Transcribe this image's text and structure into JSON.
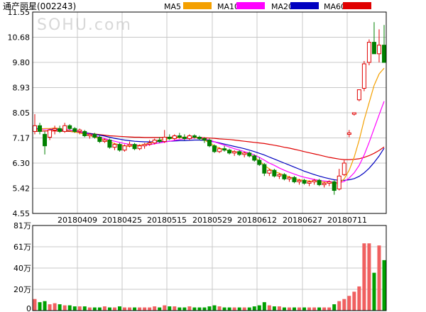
{
  "chart_data": {
    "type": "candlestick",
    "title": "通产丽星(002243)",
    "watermark": "SOHU.com",
    "price_axis": {
      "ticks": [
        "11.55",
        "10.68",
        "9.80",
        "8.93",
        "8.05",
        "7.17",
        "6.30",
        "5.42",
        "4.55"
      ],
      "min": 4.55,
      "max": 11.55
    },
    "volume_axis": {
      "ticks": [
        "81万",
        "61万",
        "40万",
        "20万",
        "0"
      ],
      "max_wan": 81
    },
    "x_tick_labels": [
      "20180409",
      "20180425",
      "20180515",
      "20180529",
      "20180612",
      "20180627",
      "20180711"
    ],
    "legend": [
      {
        "name": "MA5",
        "color": "#f4a000"
      },
      {
        "name": "MA10",
        "color": "#ff00ff"
      },
      {
        "name": "MA20",
        "color": "#0000c0"
      },
      {
        "name": "MA60",
        "color": "#e00000"
      }
    ],
    "colors": {
      "up": "#e00000",
      "down": "#008000",
      "grid": "#c8c8c8",
      "axis": "#000000"
    },
    "candles": [
      {
        "o": 7.4,
        "h": 8.0,
        "l": 7.3,
        "c": 7.6
      },
      {
        "o": 7.6,
        "h": 7.7,
        "l": 7.3,
        "c": 7.4
      },
      {
        "o": 7.3,
        "h": 7.4,
        "l": 6.6,
        "c": 6.9
      },
      {
        "o": 7.2,
        "h": 7.5,
        "l": 7.1,
        "c": 7.45
      },
      {
        "o": 7.45,
        "h": 7.6,
        "l": 7.3,
        "c": 7.5
      },
      {
        "o": 7.5,
        "h": 7.6,
        "l": 7.35,
        "c": 7.4
      },
      {
        "o": 7.4,
        "h": 7.7,
        "l": 7.35,
        "c": 7.6
      },
      {
        "o": 7.6,
        "h": 7.65,
        "l": 7.45,
        "c": 7.5
      },
      {
        "o": 7.5,
        "h": 7.55,
        "l": 7.35,
        "c": 7.4
      },
      {
        "o": 7.4,
        "h": 7.5,
        "l": 7.3,
        "c": 7.45
      },
      {
        "o": 7.4,
        "h": 7.45,
        "l": 7.2,
        "c": 7.25
      },
      {
        "o": 7.25,
        "h": 7.35,
        "l": 7.15,
        "c": 7.3
      },
      {
        "o": 7.3,
        "h": 7.35,
        "l": 7.15,
        "c": 7.2
      },
      {
        "o": 7.2,
        "h": 7.25,
        "l": 7.0,
        "c": 7.05
      },
      {
        "o": 7.05,
        "h": 7.15,
        "l": 7.0,
        "c": 7.1
      },
      {
        "o": 7.1,
        "h": 7.15,
        "l": 6.8,
        "c": 6.85
      },
      {
        "o": 6.85,
        "h": 7.0,
        "l": 6.75,
        "c": 6.95
      },
      {
        "o": 6.95,
        "h": 7.0,
        "l": 6.7,
        "c": 6.75
      },
      {
        "o": 6.75,
        "h": 6.95,
        "l": 6.7,
        "c": 6.9
      },
      {
        "o": 6.9,
        "h": 7.05,
        "l": 6.85,
        "c": 6.95
      },
      {
        "o": 6.95,
        "h": 7.0,
        "l": 6.75,
        "c": 6.8
      },
      {
        "o": 6.8,
        "h": 6.95,
        "l": 6.75,
        "c": 6.9
      },
      {
        "o": 6.9,
        "h": 7.0,
        "l": 6.8,
        "c": 6.95
      },
      {
        "o": 6.95,
        "h": 7.1,
        "l": 6.9,
        "c": 7.0
      },
      {
        "o": 7.0,
        "h": 7.15,
        "l": 6.95,
        "c": 7.1
      },
      {
        "o": 7.1,
        "h": 7.2,
        "l": 7.0,
        "c": 7.05
      },
      {
        "o": 7.05,
        "h": 7.45,
        "l": 7.0,
        "c": 7.2
      },
      {
        "o": 7.2,
        "h": 7.3,
        "l": 7.1,
        "c": 7.15
      },
      {
        "o": 7.15,
        "h": 7.3,
        "l": 7.1,
        "c": 7.25
      },
      {
        "o": 7.25,
        "h": 7.35,
        "l": 7.15,
        "c": 7.2
      },
      {
        "o": 7.2,
        "h": 7.3,
        "l": 7.1,
        "c": 7.15
      },
      {
        "o": 7.15,
        "h": 7.3,
        "l": 7.1,
        "c": 7.25
      },
      {
        "o": 7.25,
        "h": 7.3,
        "l": 7.15,
        "c": 7.2
      },
      {
        "o": 7.2,
        "h": 7.25,
        "l": 7.1,
        "c": 7.15
      },
      {
        "o": 7.15,
        "h": 7.2,
        "l": 7.0,
        "c": 7.1
      },
      {
        "o": 7.1,
        "h": 7.15,
        "l": 6.85,
        "c": 6.9
      },
      {
        "o": 6.9,
        "h": 6.95,
        "l": 6.65,
        "c": 6.7
      },
      {
        "o": 6.7,
        "h": 6.85,
        "l": 6.65,
        "c": 6.8
      },
      {
        "o": 6.8,
        "h": 6.9,
        "l": 6.7,
        "c": 6.75
      },
      {
        "o": 6.75,
        "h": 6.8,
        "l": 6.6,
        "c": 6.65
      },
      {
        "o": 6.65,
        "h": 6.75,
        "l": 6.55,
        "c": 6.7
      },
      {
        "o": 6.7,
        "h": 6.75,
        "l": 6.55,
        "c": 6.6
      },
      {
        "o": 6.6,
        "h": 6.7,
        "l": 6.5,
        "c": 6.65
      },
      {
        "o": 6.65,
        "h": 6.7,
        "l": 6.5,
        "c": 6.55
      },
      {
        "o": 6.55,
        "h": 6.6,
        "l": 6.35,
        "c": 6.4
      },
      {
        "o": 6.4,
        "h": 6.5,
        "l": 6.2,
        "c": 6.25
      },
      {
        "o": 6.25,
        "h": 6.3,
        "l": 5.85,
        "c": 5.95
      },
      {
        "o": 5.95,
        "h": 6.1,
        "l": 5.85,
        "c": 6.05
      },
      {
        "o": 6.05,
        "h": 6.1,
        "l": 5.8,
        "c": 5.85
      },
      {
        "o": 5.85,
        "h": 5.95,
        "l": 5.75,
        "c": 5.9
      },
      {
        "o": 5.9,
        "h": 5.95,
        "l": 5.7,
        "c": 5.75
      },
      {
        "o": 5.75,
        "h": 5.85,
        "l": 5.65,
        "c": 5.8
      },
      {
        "o": 5.8,
        "h": 5.85,
        "l": 5.6,
        "c": 5.65
      },
      {
        "o": 5.65,
        "h": 5.75,
        "l": 5.55,
        "c": 5.7
      },
      {
        "o": 5.7,
        "h": 5.75,
        "l": 5.55,
        "c": 5.6
      },
      {
        "o": 5.6,
        "h": 5.7,
        "l": 5.5,
        "c": 5.65
      },
      {
        "o": 5.65,
        "h": 5.75,
        "l": 5.55,
        "c": 5.7
      },
      {
        "o": 5.7,
        "h": 5.75,
        "l": 5.5,
        "c": 5.55
      },
      {
        "o": 5.55,
        "h": 5.65,
        "l": 5.45,
        "c": 5.6
      },
      {
        "o": 5.6,
        "h": 5.7,
        "l": 5.5,
        "c": 5.65
      },
      {
        "o": 5.65,
        "h": 5.7,
        "l": 5.2,
        "c": 5.35
      },
      {
        "o": 5.4,
        "h": 6.1,
        "l": 5.35,
        "c": 5.85
      },
      {
        "o": 5.9,
        "h": 6.4,
        "l": 5.85,
        "c": 6.3
      },
      {
        "o": 7.3,
        "h": 7.45,
        "l": 7.2,
        "c": 7.35
      },
      {
        "o": 8.0,
        "h": 8.05,
        "l": 7.95,
        "c": 8.05
      },
      {
        "o": 8.5,
        "h": 8.85,
        "l": 8.45,
        "c": 8.85
      },
      {
        "o": 8.9,
        "h": 9.85,
        "l": 8.8,
        "c": 9.75
      },
      {
        "o": 9.8,
        "h": 10.6,
        "l": 9.7,
        "c": 10.5
      },
      {
        "o": 10.5,
        "h": 11.2,
        "l": 10.2,
        "c": 10.1
      },
      {
        "o": 10.1,
        "h": 10.95,
        "l": 9.8,
        "c": 10.4
      },
      {
        "o": 10.4,
        "h": 11.1,
        "l": 9.9,
        "c": 9.8
      }
    ],
    "ma5": [
      7.45,
      7.48,
      7.5,
      7.5,
      7.52,
      7.5,
      7.46,
      7.42,
      7.38,
      7.35,
      7.3,
      7.26,
      7.2,
      7.15,
      7.1,
      7.03,
      6.98,
      6.93,
      6.9,
      6.88,
      6.9,
      6.92,
      6.95,
      7.0,
      7.05,
      7.1,
      7.13,
      7.15,
      7.17,
      7.18,
      7.2,
      7.2,
      7.19,
      7.17,
      7.1,
      7.0,
      6.9,
      6.82,
      6.77,
      6.73,
      6.7,
      6.67,
      6.64,
      6.6,
      6.5,
      6.38,
      6.22,
      6.1,
      6.0,
      5.95,
      5.88,
      5.82,
      5.76,
      5.72,
      5.7,
      5.68,
      5.66,
      5.65,
      5.64,
      5.63,
      5.58,
      5.6,
      5.75,
      6.05,
      6.5,
      7.1,
      7.8,
      8.4,
      9.0,
      9.4,
      9.6
    ],
    "ma10": [
      7.45,
      7.47,
      7.48,
      7.49,
      7.5,
      7.49,
      7.47,
      7.45,
      7.42,
      7.39,
      7.35,
      7.3,
      7.25,
      7.2,
      7.15,
      7.1,
      7.06,
      7.02,
      6.98,
      6.95,
      6.93,
      6.92,
      6.92,
      6.94,
      6.97,
      7.0,
      7.03,
      7.06,
      7.09,
      7.12,
      7.14,
      7.16,
      7.17,
      7.17,
      7.15,
      7.1,
      7.04,
      6.98,
      6.92,
      6.86,
      6.8,
      6.75,
      6.7,
      6.65,
      6.58,
      6.5,
      6.4,
      6.3,
      6.22,
      6.13,
      6.05,
      5.98,
      5.92,
      5.86,
      5.81,
      5.77,
      5.73,
      5.7,
      5.68,
      5.66,
      5.63,
      5.62,
      5.66,
      5.78,
      5.96,
      6.22,
      6.58,
      7.02,
      7.5,
      7.98,
      8.45
    ],
    "ma20": [
      7.5,
      7.5,
      7.49,
      7.48,
      7.47,
      7.46,
      7.44,
      7.42,
      7.4,
      7.38,
      7.36,
      7.33,
      7.3,
      7.27,
      7.24,
      7.2,
      7.16,
      7.13,
      7.1,
      7.08,
      7.06,
      7.05,
      7.04,
      7.04,
      7.04,
      7.05,
      7.05,
      7.06,
      7.07,
      7.08,
      7.08,
      7.09,
      7.1,
      7.1,
      7.09,
      7.07,
      7.04,
      7.0,
      6.96,
      6.92,
      6.88,
      6.84,
      6.8,
      6.75,
      6.7,
      6.64,
      6.58,
      6.51,
      6.44,
      6.37,
      6.3,
      6.23,
      6.16,
      6.09,
      6.02,
      5.96,
      5.9,
      5.85,
      5.8,
      5.76,
      5.72,
      5.7,
      5.7,
      5.72,
      5.76,
      5.84,
      5.96,
      6.12,
      6.32,
      6.55,
      6.82
    ],
    "ma60": [
      7.4,
      7.41,
      7.42,
      7.42,
      7.42,
      7.41,
      7.41,
      7.4,
      7.38,
      7.36,
      7.35,
      7.33,
      7.31,
      7.29,
      7.27,
      7.25,
      7.24,
      7.23,
      7.22,
      7.21,
      7.2,
      7.2,
      7.19,
      7.19,
      7.19,
      7.19,
      7.19,
      7.2,
      7.2,
      7.2,
      7.2,
      7.2,
      7.19,
      7.19,
      7.18,
      7.17,
      7.16,
      7.14,
      7.13,
      7.12,
      7.1,
      7.08,
      7.06,
      7.04,
      7.02,
      7.0,
      6.98,
      6.95,
      6.92,
      6.89,
      6.85,
      6.82,
      6.78,
      6.74,
      6.7,
      6.66,
      6.62,
      6.58,
      6.54,
      6.5,
      6.47,
      6.44,
      6.42,
      6.42,
      6.43,
      6.45,
      6.5,
      6.56,
      6.64,
      6.74,
      6.86
    ],
    "volumes_wan": [
      11,
      8,
      9,
      6,
      7,
      6,
      5,
      5,
      4,
      4,
      4,
      3,
      3,
      3,
      4,
      3,
      3,
      4,
      3,
      3,
      3,
      3,
      3,
      3,
      4,
      3,
      5,
      4,
      4,
      3,
      3,
      4,
      3,
      3,
      3,
      4,
      5,
      4,
      3,
      3,
      3,
      3,
      3,
      3,
      4,
      5,
      8,
      5,
      4,
      4,
      3,
      3,
      3,
      3,
      3,
      3,
      3,
      3,
      3,
      3,
      6,
      9,
      11,
      14,
      18,
      23,
      64,
      64,
      36,
      62,
      48
    ]
  }
}
